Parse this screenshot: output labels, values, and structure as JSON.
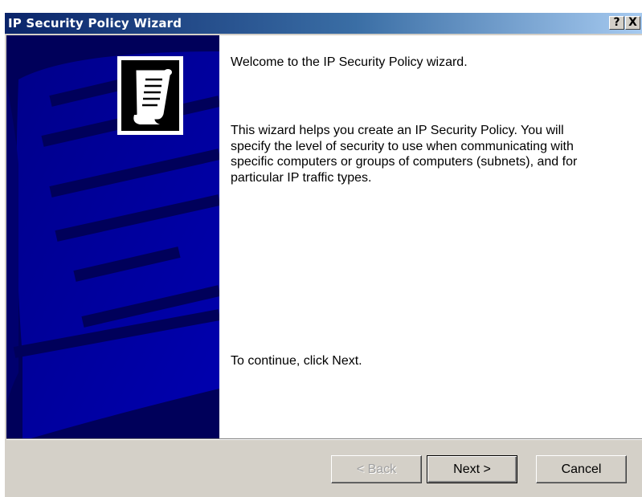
{
  "window": {
    "title": "IP Security Policy Wizard",
    "help_label": "?",
    "close_label": "X"
  },
  "content": {
    "welcome": "Welcome to the IP Security Policy wizard.",
    "description": "This wizard helps you create an IP Security Policy. You will\nspecify the level of security to use when communicating with\nspecific computers or groups of computers (subnets), and for\nparticular IP traffic types.",
    "continue_hint": "To continue, click Next."
  },
  "buttons": {
    "back": "< Back",
    "next": "Next >",
    "cancel": "Cancel"
  },
  "icons": {
    "banner": "scroll-document-icon",
    "help": "question-mark-icon",
    "close": "close-icon"
  },
  "colors": {
    "titlebar_start": "#0a246a",
    "titlebar_end": "#a6caf0",
    "banner_dark": "#00005a",
    "banner_light": "#0000a0",
    "dialog_face": "#d4d0c8"
  }
}
